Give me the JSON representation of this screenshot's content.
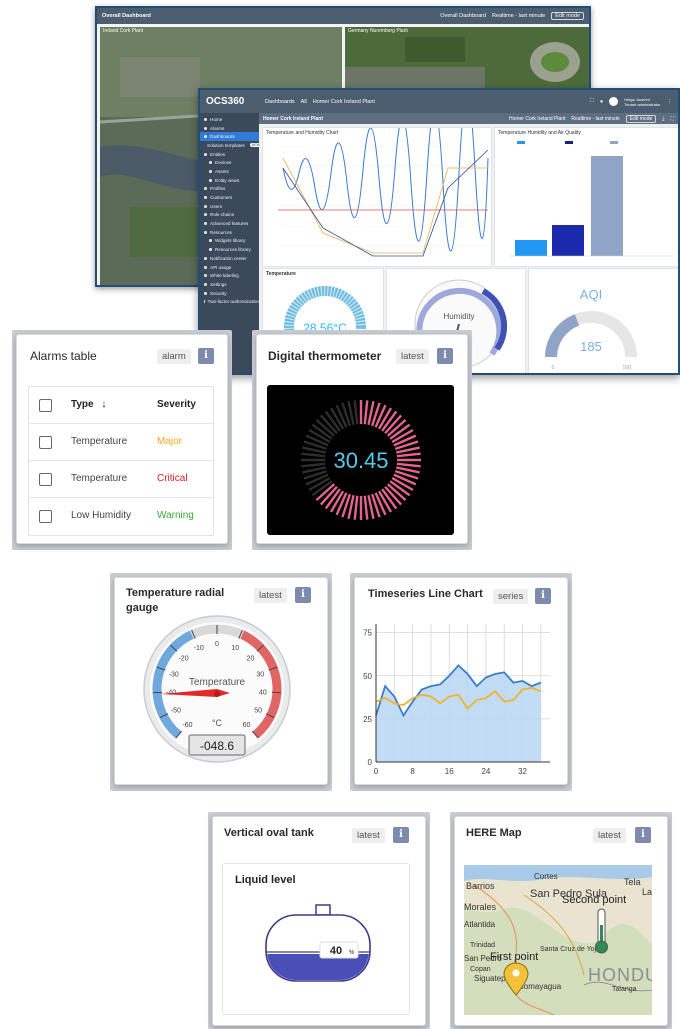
{
  "back_dashboard": {
    "title": "Overall Dashboard",
    "dashboard_select": "Overall Dashboard",
    "realtime": "Realtime - last minute",
    "edit_mode": "Edit mode",
    "panels": [
      "Ireland Cork Plant",
      "Germany Nuremberg Plant"
    ]
  },
  "front_dashboard": {
    "logo": "OCS360",
    "nav": [
      "Dashboards",
      "All",
      "Homer Cork Ireland Plant"
    ],
    "subtitle": "Homer Cork Ireland Plant",
    "plant_select": "Homer Cork Ireland Plant",
    "realtime": "Realtime - last minute",
    "edit_mode": "Edit mode",
    "user_name": "Helga Jocehni",
    "user_role": "Tenant administrator",
    "sidebar": [
      "Home",
      "Alarms",
      "Dashboards",
      "Solution templates",
      "Entities",
      "Devices",
      "Assets",
      "Entity views",
      "Profiles",
      "Customers",
      "Users",
      "Rule chains",
      "Advanced features",
      "Resources",
      "Widgets library",
      "Resources library",
      "Notification center",
      "API usage",
      "White labeling",
      "Settings",
      "Security",
      "Two-factor authentication"
    ],
    "sidebar_new_badge": "NEW",
    "panel_chart_title": "Temperature and Humidity Chart",
    "panel_bar_title": "Temperature Humidity and Air Quality",
    "panel_temp_title": "Temperature",
    "temp_value": "28.56°C",
    "humidity_label": "Humidity",
    "aqi_label": "AQI",
    "aqi_value": "185",
    "aqi_min": "0",
    "aqi_max": "500",
    "bar_legend": [
      "Hall Temperature, °C",
      "Hall Humidity, %",
      "Air Quality Index"
    ]
  },
  "alarms_card": {
    "title": "Alarms table",
    "badge": "alarm",
    "col_type": "Type",
    "col_severity": "Severity",
    "rows": [
      {
        "type": "Temperature",
        "severity": "Major",
        "color": "#f5a623"
      },
      {
        "type": "Temperature",
        "severity": "Critical",
        "color": "#e01e1e"
      },
      {
        "type": "Low Humidity",
        "severity": "Warning",
        "color": "#3aaa35"
      }
    ]
  },
  "thermometer_card": {
    "title": "Digital thermometer",
    "badge": "latest",
    "value": "30.45",
    "accent": "#e0668e"
  },
  "radial_card": {
    "title": "Temperature radial gauge",
    "badge": "latest",
    "label": "Temperature",
    "unit": "°C",
    "readout": "-048.6",
    "ticks": [
      "-60",
      "-50",
      "-40",
      "-30",
      "-20",
      "-10",
      "0",
      "10",
      "20",
      "30",
      "40",
      "50",
      "60"
    ]
  },
  "timeseries_card": {
    "title": "Timeseries Line Chart",
    "badge": "series"
  },
  "tank_card": {
    "title": "Vertical oval tank",
    "badge": "latest",
    "subtitle": "Liquid level",
    "level_text": "40",
    "level_unit": "%",
    "level": 40
  },
  "map_card": {
    "title": "HERE Map",
    "badge": "latest",
    "places": [
      "Cortes",
      "San Pedro Sula",
      "Barrios",
      "Morales",
      "Tela",
      "La",
      "Santa Cruz de Yojoa",
      "Trinidad",
      "Atlantida",
      "San Pedro",
      "Copan",
      "Siguatepeque",
      "Comayagua",
      "Talanga",
      "HONDU"
    ],
    "markers": [
      "Second point",
      "First point"
    ]
  },
  "chart_data": {
    "type": "line",
    "x": [
      0,
      2,
      4,
      6,
      8,
      10,
      12,
      14,
      16,
      18,
      20,
      22,
      24,
      26,
      28,
      30,
      32,
      34,
      36
    ],
    "series": [
      {
        "values": [
          27,
          44,
          38,
          27,
          35,
          42,
          44,
          45,
          50,
          56,
          51,
          44,
          49,
          51,
          52,
          46,
          47,
          44,
          46
        ],
        "color": "#3b7ec8"
      },
      {
        "values": [
          35,
          37,
          34,
          33,
          37,
          39,
          38,
          34,
          38,
          39,
          31,
          36,
          37,
          41,
          35,
          36,
          42,
          43,
          41
        ],
        "color": "#f1b32c"
      }
    ],
    "xticks": [
      0,
      8,
      16,
      24,
      32
    ],
    "yticks": [
      0,
      25,
      50,
      75
    ],
    "xlim": [
      0,
      38
    ],
    "ylim": [
      0,
      80
    ],
    "grid": true
  },
  "icons": {
    "info": "i",
    "sort": "↓"
  }
}
